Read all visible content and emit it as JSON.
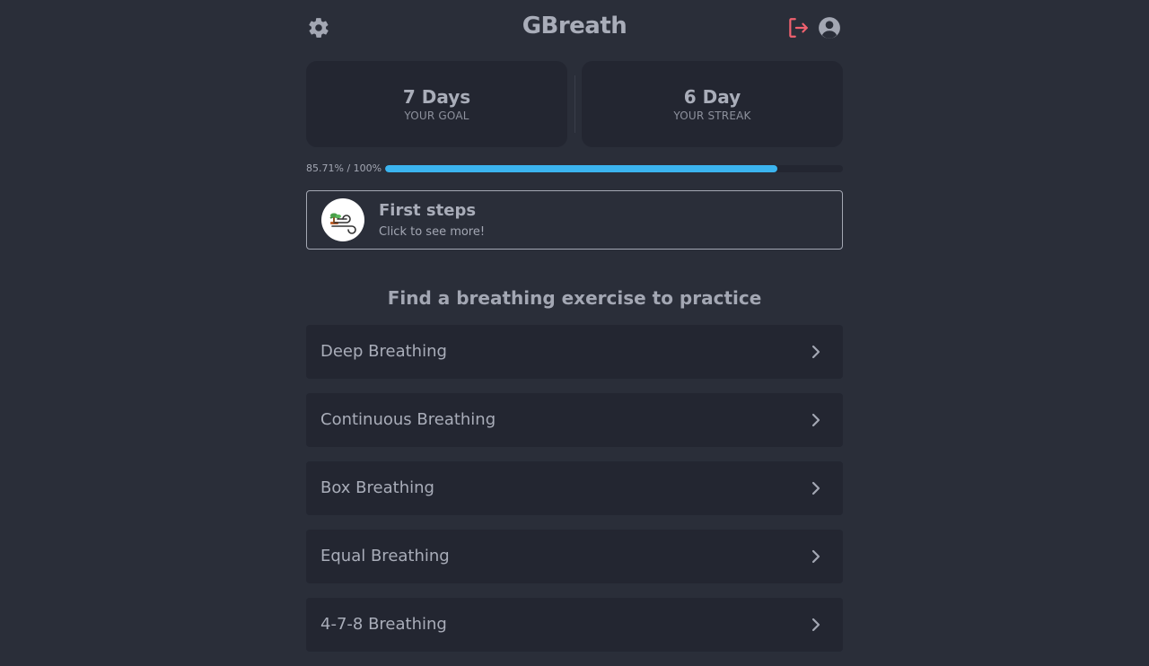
{
  "header": {
    "logo": "GBreath",
    "settings_icon": "gear-icon",
    "logout_icon": "logout-icon",
    "logout_color": "#f0616f",
    "profile_icon": "user-circle-icon"
  },
  "stats": {
    "goal": {
      "value": "7 Days",
      "label": "YOUR GOAL"
    },
    "streak": {
      "value": "6 Day",
      "label": "YOUR STREAK"
    }
  },
  "progress": {
    "text": "85.71% / 100%",
    "fraction": 0.8571,
    "color": "#3bb4ef"
  },
  "achievement": {
    "title": "First steps",
    "subtitle": "Click to see more!",
    "icon": "wind-bonsai-icon"
  },
  "section_title": "Find a breathing exercise to practice",
  "exercises": [
    {
      "label": "Deep Breathing"
    },
    {
      "label": "Continuous Breathing"
    },
    {
      "label": "Box Breathing"
    },
    {
      "label": "Equal Breathing"
    },
    {
      "label": "4-7-8 Breathing"
    }
  ]
}
